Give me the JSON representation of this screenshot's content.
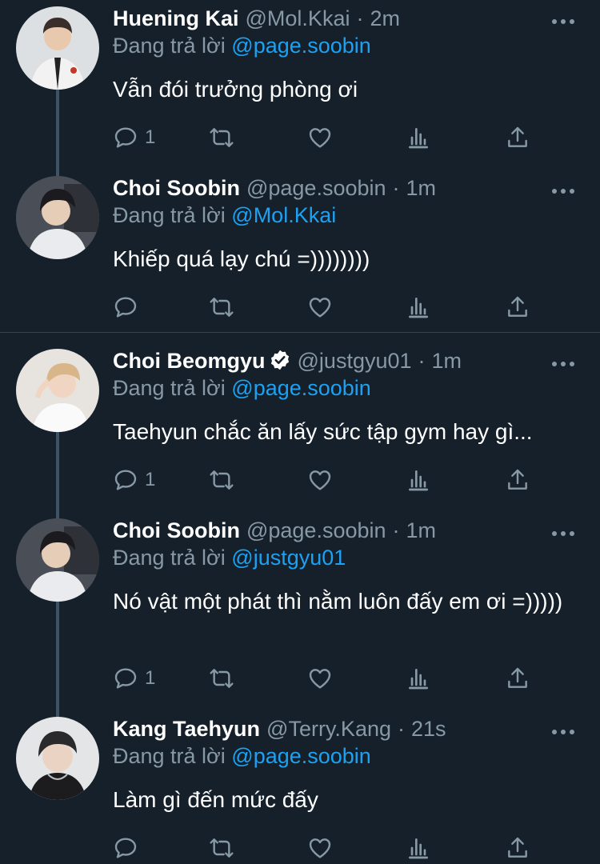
{
  "tweets": [
    {
      "name": "Huening Kai",
      "handle": "@Mol.Kkai",
      "time": "2m",
      "reply_label": "Đang trả lời",
      "reply_to": "@page.soobin",
      "text": "Vẫn đói trưởng phòng ơi",
      "reply_count": "1",
      "verified": false
    },
    {
      "name": "Choi Soobin",
      "handle": "@page.soobin",
      "time": "1m",
      "reply_label": "Đang trả lời",
      "reply_to": "@Mol.Kkai",
      "text": "Khiếp quá lạy chú =))))))))",
      "reply_count": "",
      "verified": false
    },
    {
      "name": "Choi Beomgyu",
      "handle": "@justgyu01",
      "time": "1m",
      "reply_label": "Đang trả lời",
      "reply_to": "@page.soobin",
      "text": "Taehyun chắc ăn lấy sức tập gym hay gì...",
      "reply_count": "1",
      "verified": true
    },
    {
      "name": "Choi Soobin",
      "handle": "@page.soobin",
      "time": "1m",
      "reply_label": "Đang trả lời",
      "reply_to": "@justgyu01",
      "text": "Nó vật một phát thì nằm luôn đấy em ơi =)))))",
      "reply_count": "1",
      "verified": false
    },
    {
      "name": "Kang Taehyun",
      "handle": "@Terry.Kang",
      "time": "21s",
      "reply_label": "Đang trả lời",
      "reply_to": "@page.soobin",
      "text": "Làm gì đến mức đấy",
      "reply_count": "",
      "verified": false
    }
  ],
  "separator": "·",
  "colors": {
    "background": "#15202b",
    "secondary_text": "#8899a6",
    "mention": "#1da1f2",
    "thread_line": "#3d5466",
    "divider": "#38444d"
  },
  "icons": [
    "reply-icon",
    "retweet-icon",
    "like-icon",
    "views-icon",
    "share-icon",
    "more-icon",
    "verified-icon"
  ]
}
